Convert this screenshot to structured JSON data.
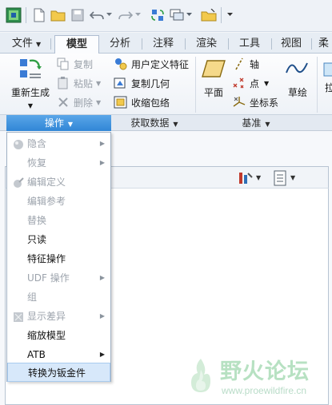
{
  "tabs": [
    {
      "label": "文件",
      "has_dropdown": true
    },
    {
      "label": "模型",
      "active": true
    },
    {
      "label": "分析"
    },
    {
      "label": "注释"
    },
    {
      "label": "渲染"
    },
    {
      "label": "工具"
    },
    {
      "label": "视图"
    },
    {
      "label": "柔"
    }
  ],
  "ribbon": {
    "regenerate": "重新生成",
    "copy": "复制",
    "paste": "粘贴",
    "delete": "删除",
    "user_defined_feature": "用户定义特征",
    "copy_geometry": "复制几何",
    "shrinkwrap": "收缩包络",
    "plane": "平面",
    "axis": "轴",
    "point": "点",
    "csys": "坐标系",
    "sketch": "草绘",
    "next_partial": "拉"
  },
  "groups": {
    "operations": "操作",
    "get_data": "获取数据",
    "datum": "基准"
  },
  "menu": [
    {
      "label": "隐含",
      "disabled": true,
      "icon": "suppress-icon",
      "submenu": true
    },
    {
      "label": "恢复",
      "disabled": true,
      "submenu": true
    },
    {
      "label": "编辑定义",
      "disabled": true,
      "icon": "edit-definition-icon"
    },
    {
      "label": "编辑参考",
      "disabled": true
    },
    {
      "label": "替换",
      "disabled": true
    },
    {
      "label": "只读",
      "disabled": false
    },
    {
      "label": "特征操作",
      "disabled": false
    },
    {
      "label": "UDF 操作",
      "disabled": true,
      "submenu": true
    },
    {
      "label": "组",
      "disabled": true
    },
    {
      "label": "显示差异",
      "disabled": true,
      "icon": "show-differences-icon",
      "submenu": true
    },
    {
      "label": "缩放模型",
      "disabled": false
    },
    {
      "label": "ATB",
      "disabled": false,
      "submenu": true
    },
    {
      "label": "转换为钣金件",
      "disabled": false,
      "highlighted": true
    }
  ],
  "watermark": {
    "title": "野火论坛",
    "url": "www.proewildfire.cn"
  },
  "colors": {
    "accent": "#3a8ad8",
    "menu_highlight": "#d7e8fa"
  }
}
